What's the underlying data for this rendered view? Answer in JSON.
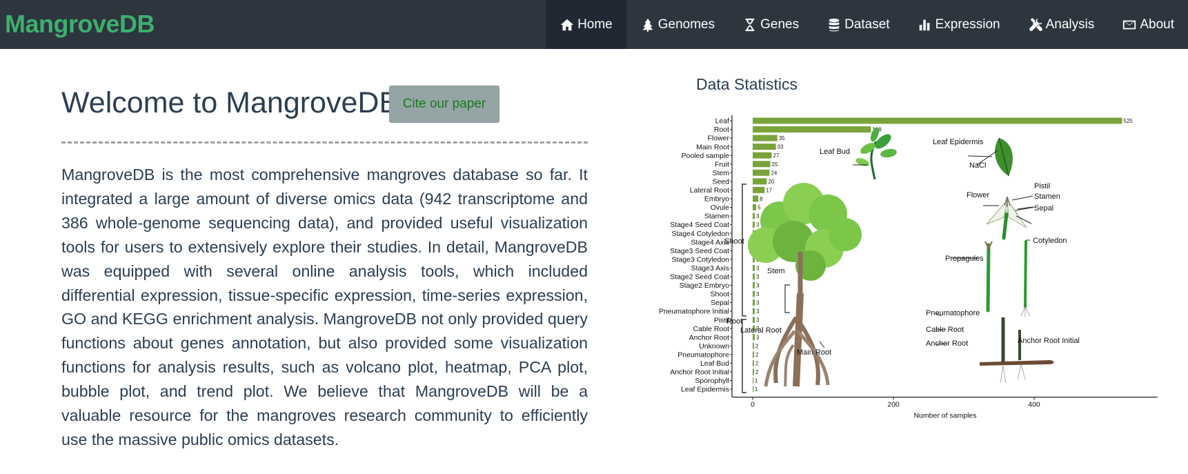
{
  "brand": "MangroveDB",
  "nav": [
    {
      "icon": "home-icon",
      "label": "Home",
      "active": true
    },
    {
      "icon": "tree-icon",
      "label": "Genomes",
      "active": false
    },
    {
      "icon": "dna-icon",
      "label": "Genes",
      "active": false
    },
    {
      "icon": "database-icon",
      "label": "Dataset",
      "active": false
    },
    {
      "icon": "bar-chart-icon",
      "label": "Expression",
      "active": false
    },
    {
      "icon": "tools-icon",
      "label": "Analysis",
      "active": false
    },
    {
      "icon": "envelope-icon",
      "label": "About",
      "active": false
    }
  ],
  "main": {
    "title": "Welcome to MangroveDB!",
    "cite_label": "Cite our paper",
    "intro": "MangroveDB is the most comprehensive mangroves database so far. It integrated a large amount of diverse omics data (942 transcriptome and 386 whole-genome sequencing data), and provided useful visualization tools for users to extensively explore their studies. In detail, MangroveDB was equipped with several online analysis tools, which included differential expression, tissue-specific expression, time-series expression, GO and KEGG enrichment analysis. MangroveDB not only provided query functions about genes annotation, but also provided some visualization functions for analysis results, such as volcano plot, heatmap, PCA plot, bubble plot, and trend plot. We believe that MangroveDB will be a valuable resource for the mangroves research community to efficiently use the massive public omics datasets."
  },
  "stats": {
    "title": "Data Statistics"
  },
  "colors": {
    "navbar": "#2d353f",
    "nav_active": "#1f2833",
    "brand": "#3db06d",
    "bar": "#7aa33a",
    "cite_button": "#95a5a6",
    "cite_text": "#1a7a1a"
  },
  "chart_data": {
    "type": "bar",
    "orientation": "horizontal",
    "categories": [
      "Leaf",
      "Root",
      "Flower",
      "Main Root",
      "Pooled sample",
      "Fruit",
      "Stem",
      "Seed",
      "Lateral Root",
      "Embryo",
      "Ovule",
      "Stamen",
      "Stage4 Seed Coat",
      "Stage4 Cotyledon",
      "Stage4 Axis",
      "Stage3 Seed Coat",
      "Stage3 Cotyledon",
      "Stage3 Axis",
      "Stage2 Seed Coat",
      "Stage2 Embryo",
      "Shoot",
      "Sepal",
      "Pneumatophore Initial",
      "Pistil",
      "Cable Root",
      "Anchor Root",
      "Unknown",
      "Pneumatophore",
      "Leaf Bud",
      "Anchor Root Initial",
      "Sporophyll",
      "Leaf Epidermis"
    ],
    "values": [
      525,
      168,
      35,
      33,
      27,
      25,
      24,
      20,
      17,
      8,
      5,
      3,
      3,
      3,
      3,
      3,
      3,
      3,
      3,
      3,
      3,
      3,
      3,
      3,
      3,
      3,
      2,
      2,
      2,
      2,
      1,
      1
    ],
    "xlabel": "Number of samples",
    "ylabel": "",
    "xlim": [
      0,
      575
    ],
    "xticks": [
      0,
      200,
      400
    ],
    "grid": false,
    "illustration_labels": [
      "Leaf Bud",
      "Leaf Epidermis",
      "NaCl",
      "Pistil",
      "Flower",
      "Stamen",
      "Sepal",
      "Cotyledon",
      "Propagules",
      "Shoot",
      "Stem",
      "Root",
      "Lateral Root",
      "Main Root",
      "Pneumatophore",
      "Cable Root",
      "Anchor Root",
      "Anchor Root Initial"
    ]
  }
}
